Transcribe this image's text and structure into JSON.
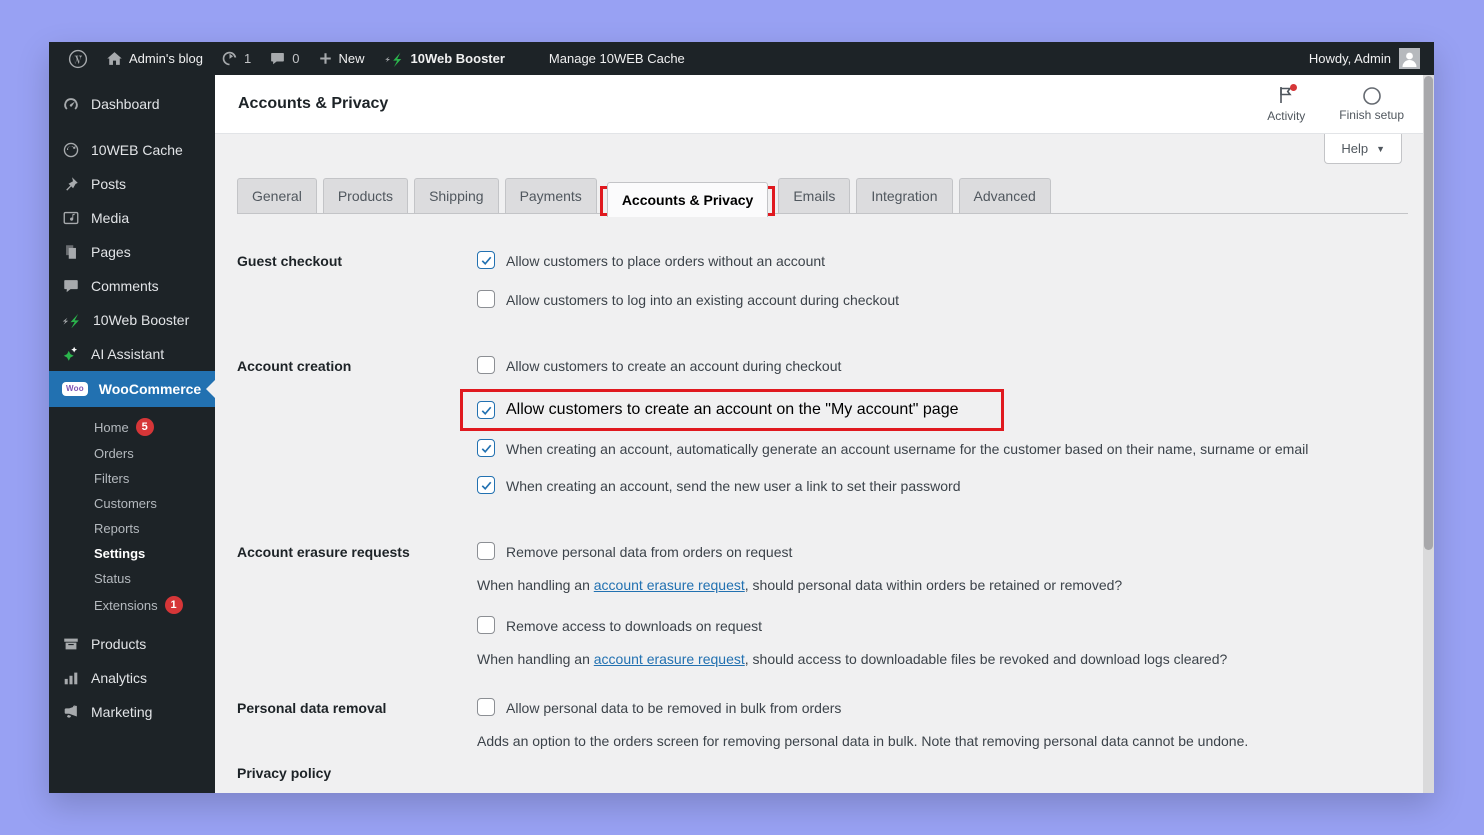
{
  "colors": {
    "accent_blue": "#2271b1",
    "annotation_red": "#e0191f",
    "badge_red": "#d63638",
    "booster_green": "#2bb54c",
    "woo_purple": "#7f54b3",
    "desktop_background": "#98a1f3"
  },
  "admin_bar": {
    "site_name": "Admin's blog",
    "updates_count": "1",
    "comments_count": "0",
    "new_label": "New",
    "booster_label": "10Web Booster",
    "manage_cache_label": "Manage 10WEB Cache",
    "howdy": "Howdy, Admin"
  },
  "sidebar": {
    "items_top": [
      {
        "label": "Dashboard"
      },
      {
        "label": "10WEB Cache"
      },
      {
        "label": "Posts"
      },
      {
        "label": "Media"
      },
      {
        "label": "Pages"
      },
      {
        "label": "Comments"
      },
      {
        "label": "10Web Booster"
      },
      {
        "label": "AI Assistant"
      }
    ],
    "woocommerce": {
      "label": "WooCommerce",
      "badge_text": "Woo"
    },
    "woo_submenu": [
      {
        "label": "Home",
        "badge": "5"
      },
      {
        "label": "Orders"
      },
      {
        "label": "Filters"
      },
      {
        "label": "Customers"
      },
      {
        "label": "Reports"
      },
      {
        "label": "Settings",
        "current": true
      },
      {
        "label": "Status"
      },
      {
        "label": "Extensions",
        "badge": "1"
      }
    ],
    "items_bottom": [
      {
        "label": "Products"
      },
      {
        "label": "Analytics"
      },
      {
        "label": "Marketing"
      }
    ]
  },
  "header": {
    "title": "Accounts & Privacy",
    "activity_label": "Activity",
    "finish_setup_label": "Finish setup",
    "help_label": "Help"
  },
  "tabs": {
    "active_index": 4,
    "items": [
      {
        "label": "General"
      },
      {
        "label": "Products"
      },
      {
        "label": "Shipping"
      },
      {
        "label": "Payments"
      },
      {
        "label": "Accounts & Privacy"
      },
      {
        "label": "Emails"
      },
      {
        "label": "Integration"
      },
      {
        "label": "Advanced"
      }
    ]
  },
  "form": {
    "sections": [
      {
        "label": "Guest checkout",
        "rows": [
          {
            "type": "checkbox",
            "checked": true,
            "text": "Allow customers to place orders without an account"
          },
          {
            "type": "checkbox",
            "checked": false,
            "text": "Allow customers to log into an existing account during checkout"
          }
        ]
      },
      {
        "label": "Account creation",
        "rows": [
          {
            "type": "checkbox",
            "checked": false,
            "text": "Allow customers to create an account during checkout"
          },
          {
            "type": "checkbox",
            "checked": true,
            "highlighted": true,
            "text": "Allow customers to create an account on the \"My account\" page"
          },
          {
            "type": "checkbox",
            "checked": true,
            "text": "When creating an account, automatically generate an account username for the customer based on their name, surname or email"
          },
          {
            "type": "checkbox",
            "checked": true,
            "text": "When creating an account, send the new user a link to set their password"
          }
        ]
      },
      {
        "label": "Account erasure requests",
        "rows": [
          {
            "type": "checkbox",
            "checked": false,
            "text": "Remove personal data from orders on request"
          },
          {
            "type": "helper",
            "prefix": "When handling an ",
            "link": "account erasure request",
            "suffix": ", should personal data within orders be retained or removed?"
          },
          {
            "type": "checkbox",
            "checked": false,
            "text": "Remove access to downloads on request"
          },
          {
            "type": "helper",
            "prefix": "When handling an ",
            "link": "account erasure request",
            "suffix": ", should access to downloadable files be revoked and download logs cleared?"
          }
        ]
      },
      {
        "label": "Personal data removal",
        "rows": [
          {
            "type": "checkbox",
            "checked": false,
            "text": "Allow personal data to be removed in bulk from orders"
          },
          {
            "type": "helper",
            "prefix": "",
            "link": "",
            "suffix": "Adds an option to the orders screen for removing personal data in bulk. Note that removing personal data cannot be undone."
          }
        ]
      }
    ],
    "cut_off_heading": "Privacy policy"
  }
}
